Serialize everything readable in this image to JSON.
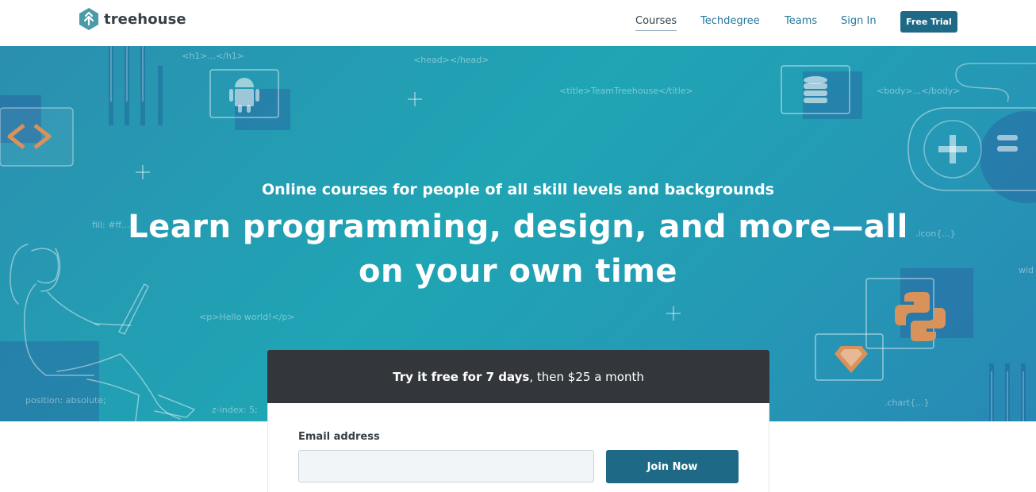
{
  "brand": {
    "name": "treehouse",
    "logo_icon": "treehouse-leaf-hexagon",
    "accent_color": "#1e6a86"
  },
  "nav": {
    "items": [
      {
        "label": "Courses",
        "active": true
      },
      {
        "label": "Techdegree",
        "active": false
      },
      {
        "label": "Teams",
        "active": false
      },
      {
        "label": "Sign In",
        "active": false
      }
    ],
    "cta_label": "Free Trial"
  },
  "hero": {
    "subtitle": "Online courses for people of all skill levels and backgrounds",
    "title": "Learn programming, design, and more—all on your own time",
    "background_snippets": [
      "<h1>...</h1>",
      "<head></head>",
      "<title>TeamTreehouse</title>",
      "<body>...</body>",
      "<p>Hello world!</p>",
      "fill: #ff...",
      ".icon{...}",
      "wid",
      "position: absolute;",
      "z-index: 5;",
      ".chart{...}"
    ],
    "icons": [
      "code-brackets-icon",
      "android-icon",
      "database-icon",
      "gamepad-icon",
      "python-icon",
      "ruby-gem-icon",
      "plus-icon"
    ]
  },
  "signup": {
    "headline_bold": "Try it free for 7 days",
    "headline_rest": ", then $25 a month",
    "email_label": "Email address",
    "email_value": "",
    "submit_label": "Join Now"
  }
}
